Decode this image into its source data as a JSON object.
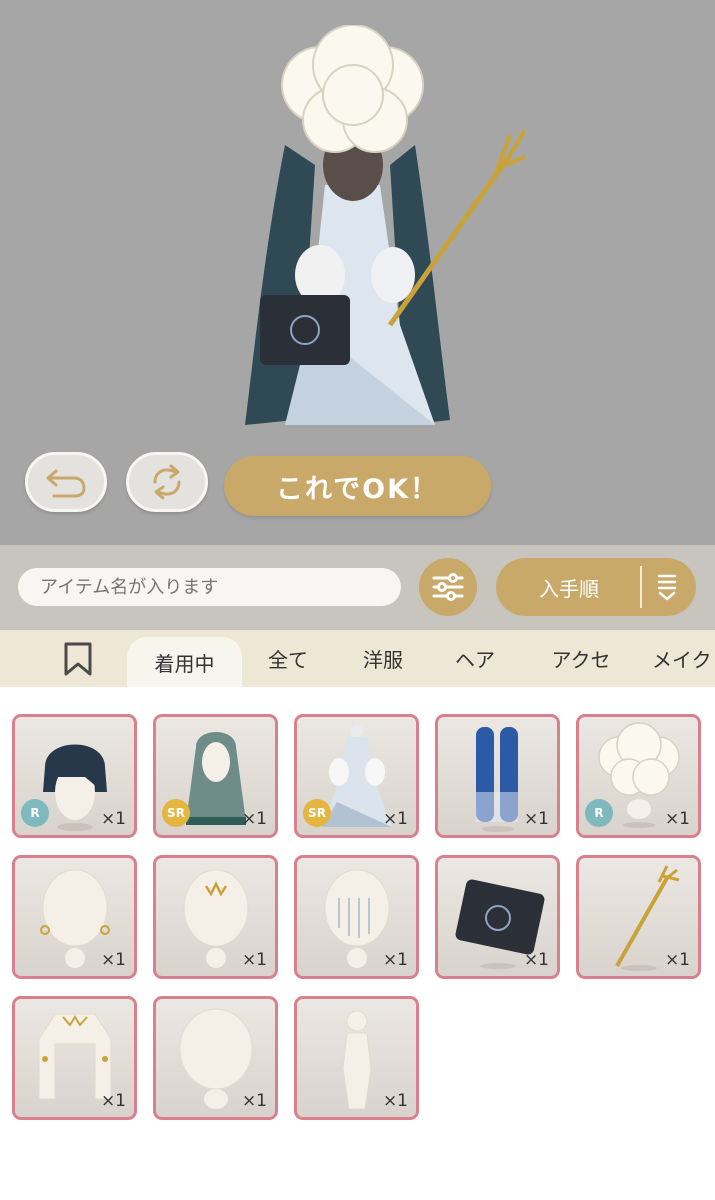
{
  "preview": {
    "ok_label": "これでOK！"
  },
  "search": {
    "placeholder": "アイテム名が入ります"
  },
  "sort": {
    "label": "入手順"
  },
  "tabs": [
    {
      "label": "着用中"
    },
    {
      "label": "全て"
    },
    {
      "label": "洋服"
    },
    {
      "label": "ヘア"
    },
    {
      "label": "アクセ"
    },
    {
      "label": "メイク"
    }
  ],
  "items": [
    {
      "icon": "black-bob-hair",
      "qty": "×1",
      "rarity": "R"
    },
    {
      "icon": "long-teal-hair",
      "qty": "×1",
      "rarity": "SR"
    },
    {
      "icon": "white-gown-dress",
      "qty": "×1",
      "rarity": "SR"
    },
    {
      "icon": "blue-leggings",
      "qty": "×1",
      "rarity": ""
    },
    {
      "icon": "white-peony-headpiece",
      "qty": "×1",
      "rarity": "R"
    },
    {
      "icon": "gold-earrings",
      "qty": "×1",
      "rarity": ""
    },
    {
      "icon": "gold-forehead-ornament",
      "qty": "×1",
      "rarity": ""
    },
    {
      "icon": "sparkle-face-veil",
      "qty": "×1",
      "rarity": ""
    },
    {
      "icon": "black-clutch-bag",
      "qty": "×1",
      "rarity": ""
    },
    {
      "icon": "gold-trident",
      "qty": "×1",
      "rarity": ""
    },
    {
      "icon": "gold-arm-jewelry",
      "qty": "×1",
      "rarity": ""
    },
    {
      "icon": "plain-face",
      "qty": "×1",
      "rarity": ""
    },
    {
      "icon": "body-base",
      "qty": "×1",
      "rarity": ""
    }
  ],
  "colors": {
    "accent_gold": "#c9a96a",
    "card_border": "#d9808e",
    "rarity_r": "#7fb9bd",
    "rarity_sr": "#e5b541"
  }
}
